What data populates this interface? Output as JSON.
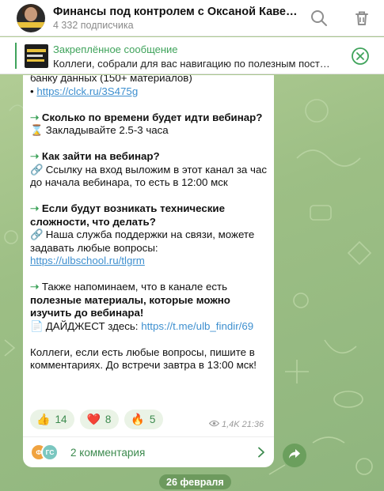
{
  "header": {
    "title": "Финансы под контролем с Оксаной Кавер…",
    "subscribers": "4 332 подписчика",
    "search_icon": "search-icon",
    "delete_icon": "trash-icon"
  },
  "pinned": {
    "title": "Закреплённое сообщение",
    "text": "Коллеги, собрали для вас навигацию по полезным пост…",
    "close_icon": "close-circle-icon"
  },
  "message": {
    "intro_line": "банку данных (150+ материалов)",
    "intro_bullet": "•",
    "intro_link": "https://clck.ru/3S475g",
    "q1_arrow": "➝",
    "q1_title": "Сколько по времени будет идти вебинар?",
    "q1_icon": "⌛",
    "q1_answer": "Закладывайте 2.5-3 часа",
    "q2_arrow": "➝",
    "q2_title": "Как зайти на вебинар?",
    "q2_icon": "🔗",
    "q2_answer": "Ссылку на вход выложим в этот канал за час до начала вебинара, то есть в 12:00 мск",
    "q3_arrow": "➝",
    "q3_title": "Если будут возникать технические сложности, что делать?",
    "q3_icon": "🔗",
    "q3_answer": "Наша служба поддержки на связи, можете задавать любые вопросы:",
    "q3_link": "https://ulbschool.ru/tlgrm",
    "q4_arrow": "➝",
    "q4_text_a": "Также напоминаем, что в канале есть",
    "q4_text_b": "полезные материалы, которые можно изучить до вебинара!",
    "q4_icon": "📄",
    "q4_label": "ДАЙДЖЕСТ здесь:",
    "q4_link": "https://t.me/ulb_findir/69",
    "outro": "Коллеги, если есть любые вопросы, пишите в комментариях. До встречи завтра в 13:00 мск!"
  },
  "reactions": [
    {
      "emoji": "👍",
      "count": "14"
    },
    {
      "emoji": "❤️",
      "count": "8"
    },
    {
      "emoji": "🔥",
      "count": "5"
    }
  ],
  "meta": {
    "views": "1,4K",
    "time": "21:36",
    "views_icon": "eye-icon"
  },
  "comments": {
    "avatar_1": "Ф",
    "avatar_2": "ГС",
    "label": "2 комментария"
  },
  "date_chip": "26 февраля",
  "colors": {
    "accent_green": "#3fa35b",
    "link_blue": "#3d8fcf",
    "reaction_bg": "#eaf3e6"
  }
}
